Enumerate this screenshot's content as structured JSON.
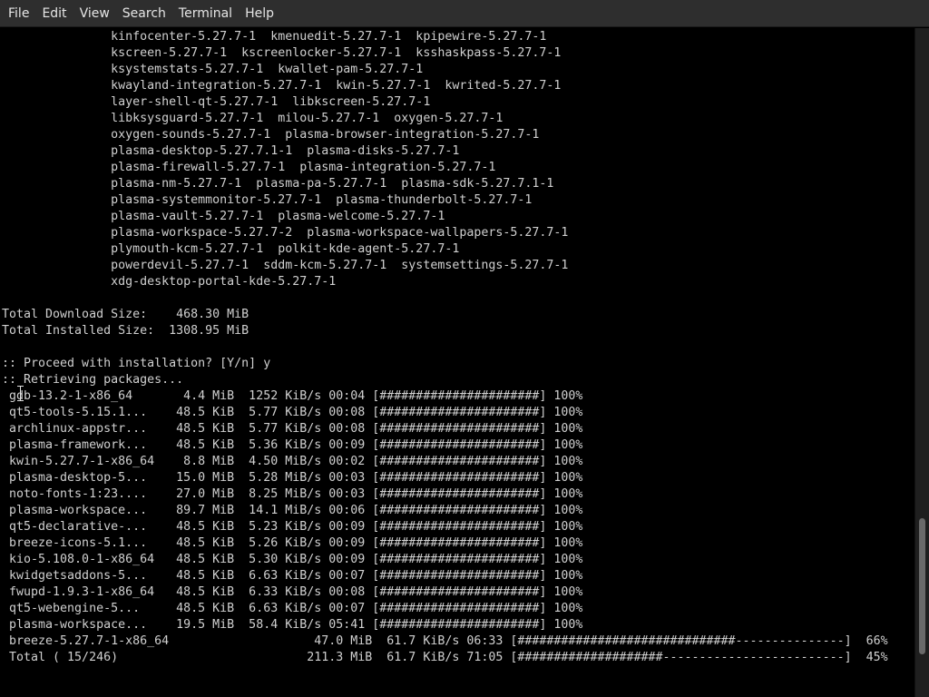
{
  "menubar": {
    "items": [
      "File",
      "Edit",
      "View",
      "Search",
      "Terminal",
      "Help"
    ]
  },
  "terminal": {
    "lines": [
      "               kinfocenter-5.27.7-1  kmenuedit-5.27.7-1  kpipewire-5.27.7-1",
      "               kscreen-5.27.7-1  kscreenlocker-5.27.7-1  ksshaskpass-5.27.7-1",
      "               ksystemstats-5.27.7-1  kwallet-pam-5.27.7-1",
      "               kwayland-integration-5.27.7-1  kwin-5.27.7-1  kwrited-5.27.7-1",
      "               layer-shell-qt-5.27.7-1  libkscreen-5.27.7-1",
      "               libksysguard-5.27.7-1  milou-5.27.7-1  oxygen-5.27.7-1",
      "               oxygen-sounds-5.27.7-1  plasma-browser-integration-5.27.7-1",
      "               plasma-desktop-5.27.7.1-1  plasma-disks-5.27.7-1",
      "               plasma-firewall-5.27.7-1  plasma-integration-5.27.7-1",
      "               plasma-nm-5.27.7-1  plasma-pa-5.27.7-1  plasma-sdk-5.27.7.1-1",
      "               plasma-systemmonitor-5.27.7-1  plasma-thunderbolt-5.27.7-1",
      "               plasma-vault-5.27.7-1  plasma-welcome-5.27.7-1",
      "               plasma-workspace-5.27.7-2  plasma-workspace-wallpapers-5.27.7-1",
      "               plymouth-kcm-5.27.7-1  polkit-kde-agent-5.27.7-1",
      "               powerdevil-5.27.7-1  sddm-kcm-5.27.7-1  systemsettings-5.27.7-1",
      "               xdg-desktop-portal-kde-5.27.7-1",
      "",
      "Total Download Size:    468.30 MiB",
      "Total Installed Size:  1308.95 MiB",
      "",
      ":: Proceed with installation? [Y/n] y",
      ":: Retrieving packages...",
      " gdb-13.2-1-x86_64       4.4 MiB  1252 KiB/s 00:04 [######################] 100%",
      " qt5-tools-5.15.1...    48.5 KiB  5.77 KiB/s 00:08 [######################] 100%",
      " archlinux-appstr...    48.5 KiB  5.77 KiB/s 00:08 [######################] 100%",
      " plasma-framework...    48.5 KiB  5.36 KiB/s 00:09 [######################] 100%",
      " kwin-5.27.7-1-x86_64    8.8 MiB  4.50 MiB/s 00:02 [######################] 100%",
      " plasma-desktop-5...    15.0 MiB  5.28 MiB/s 00:03 [######################] 100%",
      " noto-fonts-1:23....    27.0 MiB  8.25 MiB/s 00:03 [######################] 100%",
      " plasma-workspace...    89.7 MiB  14.1 MiB/s 00:06 [######################] 100%",
      " qt5-declarative-...    48.5 KiB  5.23 KiB/s 00:09 [######################] 100%",
      " breeze-icons-5.1...    48.5 KiB  5.26 KiB/s 00:09 [######################] 100%",
      " kio-5.108.0-1-x86_64   48.5 KiB  5.30 KiB/s 00:09 [######################] 100%",
      " kwidgetsaddons-5...    48.5 KiB  6.63 KiB/s 00:07 [######################] 100%",
      " fwupd-1.9.3-1-x86_64   48.5 KiB  6.33 KiB/s 00:08 [######################] 100%",
      " qt5-webengine-5...     48.5 KiB  6.63 KiB/s 00:07 [######################] 100%",
      " plasma-workspace...    19.5 MiB  58.4 KiB/s 05:41 [######################] 100%",
      " breeze-5.27.7-1-x86_64                    47.0 MiB  61.7 KiB/s 06:33 [##############################---------------]  66%",
      " Total ( 15/246)                          211.3 MiB  61.7 KiB/s 71:05 [####################-------------------------]  45%"
    ]
  },
  "scrollbar": {
    "position_fraction": 0.93
  },
  "colors": {
    "background": "#000000",
    "text": "#d0d0d0",
    "menubar": "#2e2e2e",
    "menu_text": "#e6e6e6"
  }
}
